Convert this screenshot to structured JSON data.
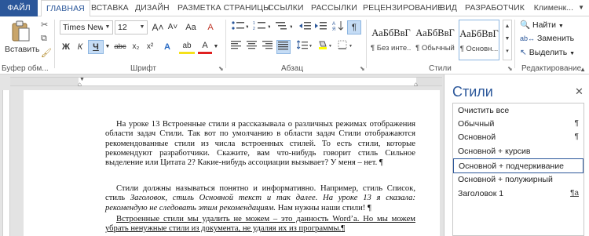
{
  "tabs": [
    "ФАЙЛ",
    "ГЛАВНАЯ",
    "ВСТАВКА",
    "ДИЗАЙН",
    "РАЗМЕТКА СТРАНИЦЫ",
    "ССЫЛКИ",
    "РАССЫЛКИ",
    "РЕЦЕНЗИРОВАНИЕ",
    "ВИД",
    "РАЗРАБОТЧИК"
  ],
  "user": "Клименк...",
  "clipboard": {
    "paste_label": "Вставить",
    "group_label": "Буфер обм..."
  },
  "font": {
    "name": "Times New F",
    "size": "12",
    "grow": "A˄",
    "shrink": "A˅",
    "case": "Aa",
    "clear": "A",
    "bold": "Ж",
    "italic": "К",
    "underline": "Ч",
    "strike": "abc",
    "subscript": "x₂",
    "superscript": "x²",
    "effects": "A",
    "highlight": "ab",
    "color": "A",
    "group_label": "Шрифт"
  },
  "paragraph": {
    "show_marks": "¶",
    "group_label": "Абзац"
  },
  "styles_gallery": [
    {
      "sample": "АаБбВвГ",
      "name": "¶ Без инте..."
    },
    {
      "sample": "АаБбВвГ",
      "name": "¶ Обычный"
    },
    {
      "sample": "АаБбВвГ",
      "name": "¶ Основн..."
    }
  ],
  "styles_group_label": "Стили",
  "editing": {
    "find": "Найти",
    "replace": "Заменить",
    "select": "Выделить",
    "group_label": "Редактирование"
  },
  "document": {
    "para1": "На уроке 13 Встроенные стили я рассказывала о различных режимах отображения области задач Стили. Так вот по умолчанию в области задач Стили отображаются рекомендованные стили из числа встроенных стилей. То есть стили, которые рекомендуют разработчики. Скажите, вам что-нибудь говорит стиль Сильное выделение или Цитата 2? Какие-нибудь ассоциации вызывает? У меня – нет. ¶",
    "para2_a": "Стили должны называться понятно и информативно. Например, стиль Список, стиль ",
    "para2_b": "Заголовок, стиль Основной текст и так далее. На уроке 13 я сказала: рекомендую не следовать этим рекомендациям.",
    "para2_c": " Нам нужны наши стили! ¶",
    "para3": "Встроенные стили мы удалить не можем – это данность Word’а. Но мы можем убрать ненужные стили из документа, не удаляя их из программы.¶"
  },
  "pane": {
    "title": "Стили",
    "items": [
      {
        "label": "Очистить все",
        "mark": ""
      },
      {
        "label": "Обычный",
        "mark": "¶"
      },
      {
        "label": "Основной",
        "mark": "¶"
      },
      {
        "label": "Основной + курсив",
        "mark": ""
      },
      {
        "label": "Основной + подчеркивание",
        "mark": ""
      },
      {
        "label": "Основной + полужирный",
        "mark": ""
      },
      {
        "label": "Заголовок 1",
        "mark": "¶a"
      }
    ]
  }
}
